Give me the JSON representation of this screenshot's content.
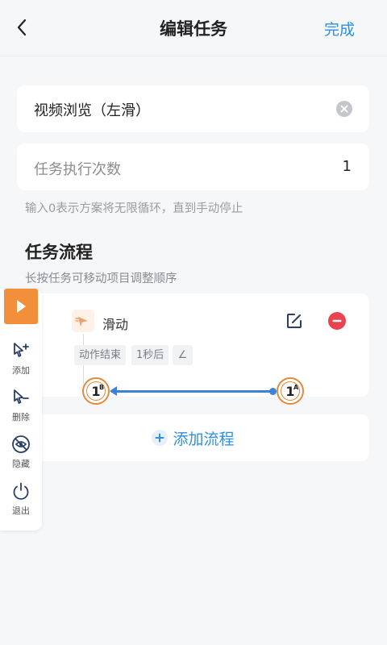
{
  "header": {
    "title": "编辑任务",
    "done_label": "完成"
  },
  "task": {
    "name": "视频浏览（左滑）",
    "count_label": "任务执行次数",
    "count_value": "1",
    "hint": "输入0表示方案将无限循环，直到手动停止"
  },
  "flow": {
    "title": "任务流程",
    "subtitle": "长按任务可移动项目调整顺序",
    "step": {
      "label": "滑动",
      "tags": [
        "动作结束",
        "1秒后",
        "∠"
      ]
    },
    "add_label": "添加流程"
  },
  "markers": {
    "start": {
      "num": "1",
      "sup": "A"
    },
    "end": {
      "num": "1",
      "sup": "B"
    }
  },
  "sidebar": {
    "items": [
      {
        "label": "添加",
        "icon": "cursor-plus-icon"
      },
      {
        "label": "删除",
        "icon": "cursor-minus-icon"
      },
      {
        "label": "隐藏",
        "icon": "eye-off-icon"
      },
      {
        "label": "退出",
        "icon": "power-icon"
      }
    ]
  },
  "colors": {
    "accent": "#2f8fe0",
    "orange": "#f28f3b",
    "remove": "#e8434f",
    "swipe_line": "#3b82d8"
  }
}
